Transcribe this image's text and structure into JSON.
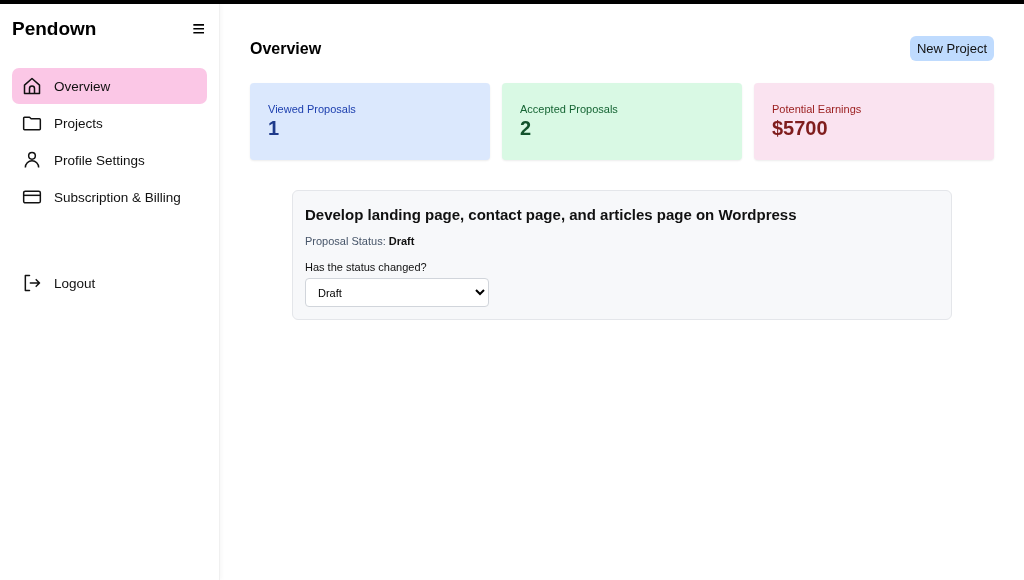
{
  "sidebar": {
    "brand": "Pendown",
    "menu_icon": "≡",
    "items": [
      {
        "label": "Overview",
        "selected": true
      },
      {
        "label": "Projects",
        "selected": false
      },
      {
        "label": "Profile Settings",
        "selected": false
      },
      {
        "label": "Subscription & Billing",
        "selected": false
      }
    ],
    "logout": "Logout"
  },
  "header": {
    "title": "Overview",
    "button": "New Project"
  },
  "stats": [
    {
      "label": "Viewed Proposals",
      "value": "1",
      "color": "#dbe8fd"
    },
    {
      "label": "Accepted Proposals",
      "value": "2",
      "color": "#d9f9e4"
    },
    {
      "label": "Potential Earnings",
      "value": "$5700",
      "color": "#fae3f0"
    }
  ],
  "proposal": {
    "title": "Develop landing page, contact page, and articles page on Wordpress",
    "status": "Proposal Status: **Draft**",
    "question": "Has the status changed?",
    "select_value": "Draft"
  }
}
